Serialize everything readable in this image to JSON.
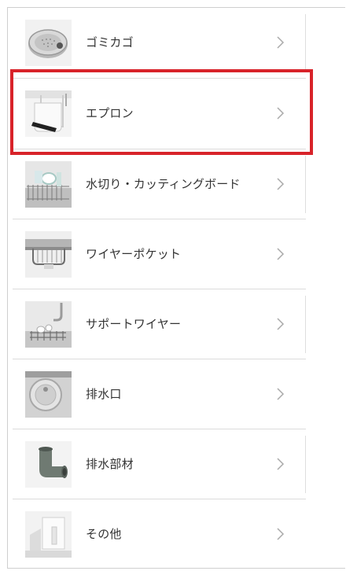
{
  "menu": {
    "items": [
      {
        "label": "ゴミカゴ",
        "icon": "drain-basket-thumbnail"
      },
      {
        "label": "エプロン",
        "icon": "sink-apron-thumbnail"
      },
      {
        "label": "水切り・カッティングボード",
        "icon": "drying-rack-thumbnail"
      },
      {
        "label": "ワイヤーポケット",
        "icon": "wire-pocket-thumbnail"
      },
      {
        "label": "サポートワイヤー",
        "icon": "support-wire-thumbnail"
      },
      {
        "label": "排水口",
        "icon": "drain-outlet-thumbnail"
      },
      {
        "label": "排水部材",
        "icon": "drain-pipe-thumbnail"
      },
      {
        "label": "その他",
        "icon": "other-parts-thumbnail"
      }
    ],
    "highlighted_index": 1,
    "highlight_color": "#d8232a",
    "chevron_icon": "chevron-right-icon"
  }
}
